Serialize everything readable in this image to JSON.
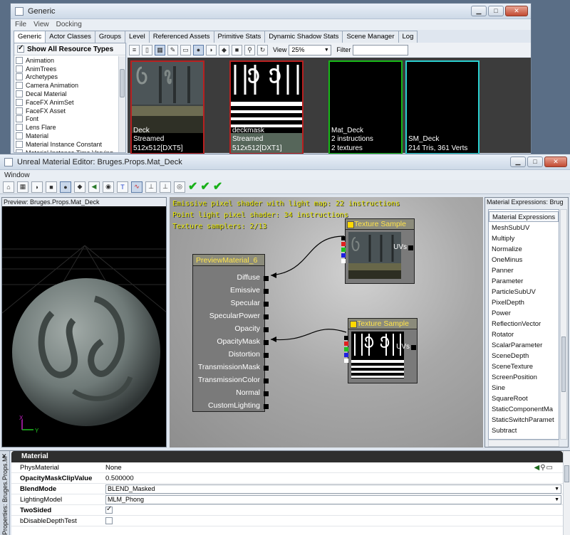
{
  "generic": {
    "title": "Generic",
    "menu": [
      "File",
      "View",
      "Docking"
    ],
    "tabs": [
      "Generic",
      "Actor Classes",
      "Groups",
      "Level",
      "Referenced Assets",
      "Primitive Stats",
      "Dynamic Shadow Stats",
      "Scene Manager",
      "Log"
    ],
    "show_all_label": "Show All Resource Types",
    "resource_types": [
      "Animation",
      "AnimTrees",
      "Archetypes",
      "Camera Animation",
      "Decal Material",
      "FaceFX AnimSet",
      "FaceFX Asset",
      "Font",
      "Lens Flare",
      "Material",
      "Material Instance Constant",
      "Material Instance Time Varying"
    ],
    "view_label": "View",
    "zoom_value": "25%",
    "filter_label": "Filter",
    "thumbnails": [
      {
        "name": "Deck",
        "info": "Streamed 512x512[DXT5]",
        "extra": "",
        "border": "#b82020"
      },
      {
        "name": "deckmask",
        "info": "Streamed 512x512[DXT1]",
        "extra": "",
        "border": "#b82020"
      },
      {
        "name": "Mat_Deck",
        "info": "2 instructions",
        "extra": "2 textures",
        "border": "#18b818"
      },
      {
        "name": "SM_Deck",
        "info": "214 Tris, 361 Verts",
        "extra": "",
        "border": "#2ad0d0"
      }
    ]
  },
  "editor": {
    "title": "Unreal Material Editor: Bruges.Props.Mat_Deck",
    "menu": "Window",
    "preview_label": "Preview: Bruges.Props.Mat_Deck",
    "axis_x": "X",
    "axis_y": "Y",
    "stats": [
      "Emissive pixel shader with light map: 22 instructions",
      "Point light pixel shader: 34 instructions",
      "Texture samplers: 2/13"
    ],
    "main_node": {
      "title": "PreviewMaterial_6",
      "pins": [
        "Diffuse",
        "Emissive",
        "Specular",
        "SpecularPower",
        "Opacity",
        "OpacityMask",
        "Distortion",
        "TransmissionMask",
        "TransmissionColor",
        "Normal",
        "CustomLighting"
      ]
    },
    "tex_nodes": [
      {
        "title": "Texture Sample",
        "output": "UVs"
      },
      {
        "title": "Texture Sample",
        "output": "UVs"
      }
    ],
    "expr_title": "Material Expressions: Brug",
    "expr_header": "Material Expressions",
    "expressions": [
      "MeshSubUV",
      "Multiply",
      "Normalize",
      "OneMinus",
      "Panner",
      "Parameter",
      "ParticleSubUV",
      "PixelDepth",
      "Power",
      "ReflectionVector",
      "Rotator",
      "ScalarParameter",
      "SceneDepth",
      "SceneTexture",
      "ScreenPosition",
      "Sine",
      "SquareRoot",
      "StaticComponentMa",
      "StaticSwitchParamet",
      "Subtract"
    ]
  },
  "properties": {
    "side_label": "Properties: Bruges.Props.M",
    "category": "Material",
    "rows": [
      {
        "name": "PhysMaterial",
        "value": "None",
        "kind": "text",
        "bold": false
      },
      {
        "name": "OpacityMaskClipValue",
        "value": "0.500000",
        "kind": "text",
        "bold": true
      },
      {
        "name": "BlendMode",
        "value": "BLEND_Masked",
        "kind": "combo",
        "bold": true
      },
      {
        "name": "LightingModel",
        "value": "MLM_Phong",
        "kind": "combo",
        "bold": false
      },
      {
        "name": "TwoSided",
        "value": "",
        "kind": "check_on",
        "bold": true
      },
      {
        "name": "bDisableDepthTest",
        "value": "",
        "kind": "check_off",
        "bold": false
      }
    ]
  },
  "colors": {
    "stat_text": "#e8e800",
    "node_title": "#ffe44a",
    "check_green": "#18b018"
  }
}
